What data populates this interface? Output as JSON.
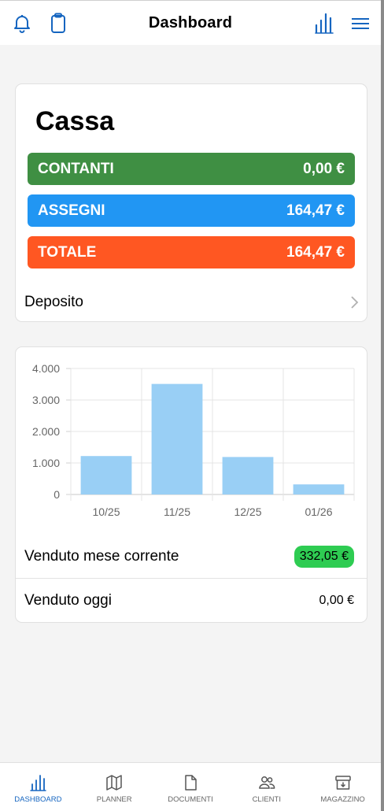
{
  "header": {
    "title": "Dashboard",
    "left_icons": [
      "bell-icon",
      "clipboard-icon"
    ],
    "right_icons": [
      "bar-chart-icon",
      "menu-icon"
    ],
    "accent": "#1565c0"
  },
  "cassa": {
    "title": "Cassa",
    "rows": [
      {
        "label": "CONTANTI",
        "value": "0,00 €",
        "color": "#3f8f43"
      },
      {
        "label": "ASSEGNI",
        "value": "164,47 €",
        "color": "#2196f3"
      },
      {
        "label": "TOTALE",
        "value": "164,47 €",
        "color": "#ff5722"
      }
    ],
    "deposito_label": "Deposito"
  },
  "chart_data": {
    "type": "bar",
    "categories": [
      "10/25",
      "11/25",
      "12/25",
      "01/26"
    ],
    "values": [
      1220,
      3510,
      1190,
      320
    ],
    "ylim": [
      0,
      4000
    ],
    "yticks": [
      "4.000",
      "3.000",
      "2.000",
      "1.000",
      "0"
    ],
    "grid": true,
    "bar_color": "#99cff5"
  },
  "stats": {
    "month_label": "Venduto mese corrente",
    "month_value": "332,05 €",
    "today_label": "Venduto oggi",
    "today_value": "0,00 €"
  },
  "tabs": [
    {
      "label": "DASHBOARD",
      "icon": "bar-chart-icon",
      "active": true
    },
    {
      "label": "PLANNER",
      "icon": "map-icon",
      "active": false
    },
    {
      "label": "DOCUMENTI",
      "icon": "document-icon",
      "active": false
    },
    {
      "label": "CLIENTI",
      "icon": "people-icon",
      "active": false
    },
    {
      "label": "MAGAZZINO",
      "icon": "archive-icon",
      "active": false
    }
  ]
}
